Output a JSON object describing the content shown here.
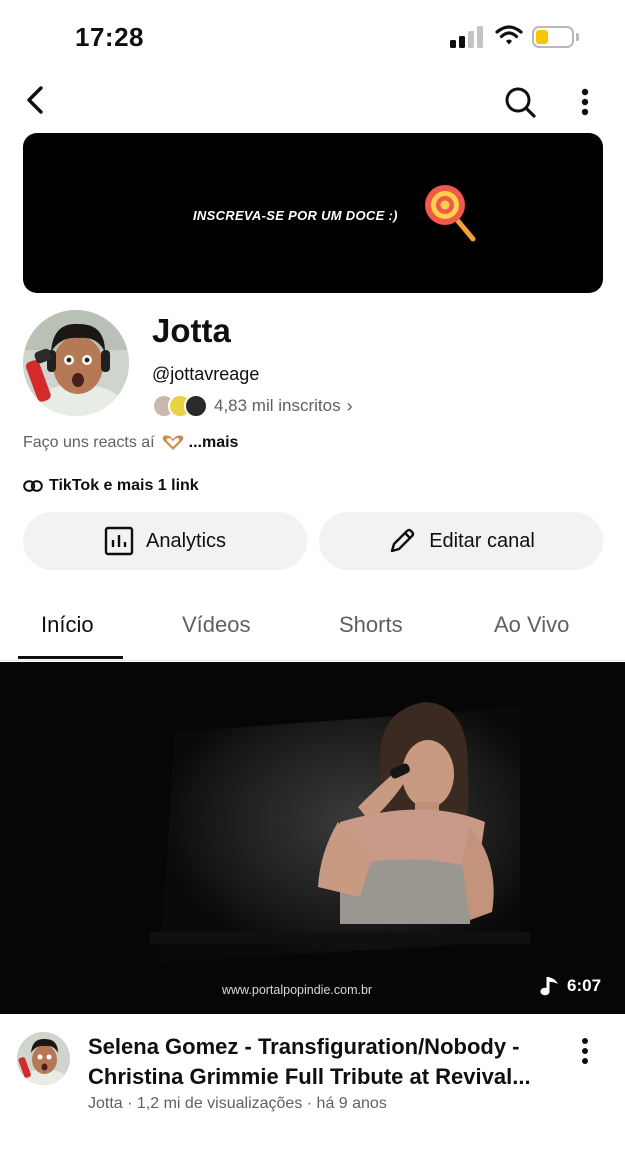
{
  "status_bar": {
    "time": "17:28",
    "battery_level": 0.35
  },
  "header": {
    "back_icon": "chevron-left-icon",
    "search_icon": "search-icon",
    "more_icon": "more-vert-icon"
  },
  "banner": {
    "text": "INSCREVA-SE POR UM DOCE :)",
    "emoji_icon": "lollipop-icon"
  },
  "channel": {
    "name": "Jotta",
    "handle": "@jottavreage",
    "subscribers": "4,83 mil inscritos",
    "subs_chevron": "›",
    "description": "Faço uns reacts aí",
    "description_more": "...mais",
    "links": "TikTok e mais 1 link"
  },
  "buttons": {
    "analytics": "Analytics",
    "edit_channel": "Editar canal"
  },
  "tabs": [
    {
      "label": "Início",
      "active": true
    },
    {
      "label": "Vídeos",
      "active": false
    },
    {
      "label": "Shorts",
      "active": false
    },
    {
      "label": "Ao Vivo",
      "active": false
    }
  ],
  "video": {
    "watermark": "www.portalpopindie.com.br",
    "duration": "6:07",
    "title_line1": "Selena Gomez - Transfiguration/Nobody -",
    "title_line2": "Christina Grimmie Full Tribute at Revival...",
    "meta": "Jotta · 1,2 mi de visualizações · há 9 anos"
  },
  "colors": {
    "text": "#0f0f0f",
    "secondary": "#606060",
    "button_bg": "#f2f2f2",
    "battery": "#f7c600"
  }
}
